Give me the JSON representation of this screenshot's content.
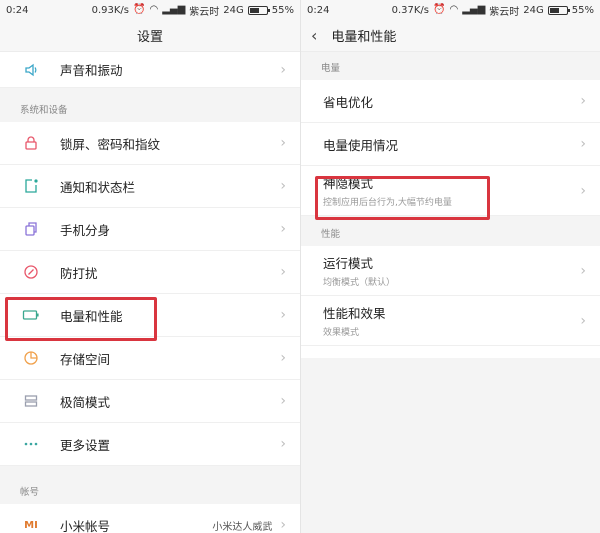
{
  "left": {
    "status": {
      "time": "0:24",
      "speed": "0.93K/s",
      "carrier": "紫云时",
      "network": "24G",
      "battery": "55%",
      "battery_level": 0.55
    },
    "title": "设置",
    "top_item": {
      "label": "声音和振动",
      "icon": "speaker-icon"
    },
    "section_system": "系统和设备",
    "items": [
      {
        "label": "锁屏、密码和指纹",
        "icon": "lock-icon",
        "color": "#e8566a"
      },
      {
        "label": "通知和状态栏",
        "icon": "notification-icon",
        "color": "#2aa89a"
      },
      {
        "label": "手机分身",
        "icon": "clone-icon",
        "color": "#8a73d8"
      },
      {
        "label": "防打扰",
        "icon": "do-not-disturb-icon",
        "color": "#e8566a"
      },
      {
        "label": "电量和性能",
        "icon": "battery-icon",
        "color": "#3aa88f"
      },
      {
        "label": "存储空间",
        "icon": "storage-icon",
        "color": "#f0a04a"
      },
      {
        "label": "极简模式",
        "icon": "simple-mode-icon",
        "color": "#9a9fae"
      },
      {
        "label": "更多设置",
        "icon": "more-icon",
        "color": "#3aa6a0"
      }
    ],
    "section_account": "帐号",
    "account_item": {
      "label": "小米帐号",
      "value": "小米达人威武",
      "icon": "mi-icon",
      "glyph": "MI"
    }
  },
  "right": {
    "status": {
      "time": "0:24",
      "speed": "0.37K/s",
      "carrier": "紫云时",
      "network": "24G",
      "battery": "55%",
      "battery_level": 0.55
    },
    "title": "电量和性能",
    "section_power": "电量",
    "power_items": [
      {
        "label": "省电优化"
      },
      {
        "label": "电量使用情况"
      },
      {
        "label": "神隐模式",
        "sub": "控制应用后台行为,大幅节约电量"
      }
    ],
    "section_perf": "性能",
    "perf_items": [
      {
        "label": "运行模式",
        "sub": "均衡模式（默认）"
      },
      {
        "label": "性能和效果",
        "sub": "效果模式"
      }
    ]
  }
}
